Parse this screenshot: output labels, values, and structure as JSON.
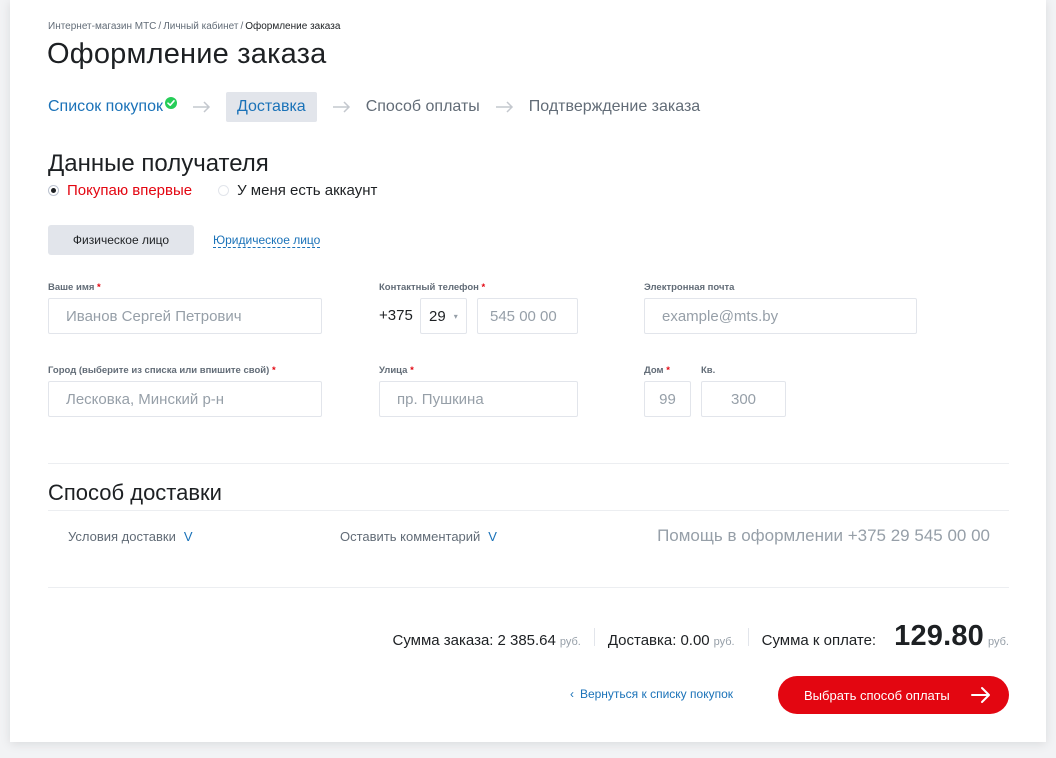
{
  "breadcrumb": [
    {
      "label": "Интернет-магазин МТС"
    },
    {
      "label": "Личный кабинет"
    },
    {
      "label": "Оформление заказа"
    }
  ],
  "breadcrumb_separator": "/",
  "page_title": "Оформление заказа",
  "steps": [
    {
      "label": "Список покупок",
      "state": "done"
    },
    {
      "label": "Доставка",
      "state": "active"
    },
    {
      "label": "Способ оплаты",
      "state": "pending"
    },
    {
      "label": "Подтверждение заказа",
      "state": "pending"
    }
  ],
  "recipient": {
    "title": "Данные получателя",
    "radio_new": "Покупаю впервые",
    "radio_account": "У меня есть аккаунт",
    "person_individual": "Физическое лицо",
    "person_legal": "Юридическое лицо"
  },
  "form": {
    "required_mark": "*",
    "name_label": "Ваше имя",
    "name_placeholder": "Иванов Сергей Петрович",
    "phone_label": "Контактный телефон",
    "phone_prefix": "+375",
    "phone_code": "29",
    "phone_placeholder": "545 00 00",
    "email_label": "Электронная почта",
    "email_placeholder": "example@mts.by",
    "city_label": "Город (выберите из списка или впишите свой)",
    "city_placeholder": "Лесковка, Минский р-н",
    "street_label": "Улица",
    "street_placeholder": "пр. Пушкина",
    "house_label": "Дом",
    "house_placeholder": "99",
    "apt_label": "Кв.",
    "apt_placeholder": "300"
  },
  "delivery": {
    "title": "Способ доставки",
    "conditions": "Условия доставки",
    "comment": "Оставить комментарий",
    "help": "Помощь в оформлении +375 29 545 00 00",
    "toggle_glyph": "V"
  },
  "totals": {
    "order_label": "Сумма заказа:",
    "order_value": "2 385.64",
    "delivery_label": "Доставка:",
    "delivery_value": "0.00",
    "pay_label": "Сумма к оплате:",
    "pay_value": "129.80",
    "currency": "руб."
  },
  "actions": {
    "back": "Вернуться к списку покупок",
    "back_chevron": "‹",
    "next": "Выбрать способ оплаты"
  },
  "colors": {
    "accent_red": "#e30611",
    "link_blue": "#1a72b8",
    "success_green": "#26cd58"
  }
}
